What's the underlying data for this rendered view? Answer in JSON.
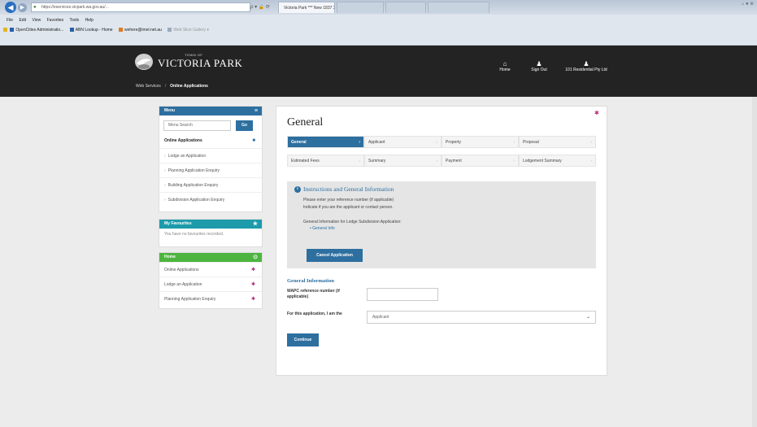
{
  "browser": {
    "url": "https://eservices.vicpark.wa.gov.au/...",
    "tabs": [
      "Victoria Park *** New 1837 3...",
      "",
      "",
      ""
    ],
    "menu": [
      "File",
      "Edit",
      "View",
      "Favorites",
      "Tools",
      "Help"
    ],
    "favorites": [
      "OpenCities Administratio...",
      "ABN Lookup - Home",
      "wehere@imel.net.au",
      "Web Slice Gallery ▾"
    ]
  },
  "site": {
    "logo_small": "TOWN OF",
    "logo_main": "VICTORIA PARK",
    "breadcrumb": [
      "Web Services",
      "/",
      "Online Applications"
    ],
    "header_links": [
      {
        "label": "Home",
        "icon": "home-icon"
      },
      {
        "label": "Sign Out",
        "icon": "user-icon"
      },
      {
        "label": "101 Residential Pty Ltd",
        "icon": "user-icon"
      }
    ]
  },
  "sidebar": {
    "menu_title": "Menu",
    "search_placeholder": "Menu Search",
    "search_btn": "Go",
    "menu_items": [
      {
        "label": "Online Applications"
      },
      {
        "label": "Lodge an Application"
      },
      {
        "label": "Planning Application Enquiry"
      },
      {
        "label": "Building Application Enquiry"
      },
      {
        "label": "Subdivision Application Enquiry"
      }
    ],
    "favourites_title": "My Favourites",
    "favourites_empty": "You have no favourites recorded.",
    "home_title": "Home",
    "home_items": [
      {
        "label": "Online Applications"
      },
      {
        "label": "Lodge an Application"
      },
      {
        "label": "Planning Application Enquiry"
      }
    ]
  },
  "main": {
    "title": "General",
    "steps": [
      {
        "label": "General",
        "active": true
      },
      {
        "label": "Applicant",
        "active": false
      },
      {
        "label": "Property",
        "active": false
      },
      {
        "label": "Proposal",
        "active": false
      },
      {
        "label": "Estimated Fees",
        "active": false
      },
      {
        "label": "Summary",
        "active": false
      },
      {
        "label": "Payment",
        "active": false
      },
      {
        "label": "Lodgement Summary",
        "active": false
      }
    ],
    "info_title": "Instructions and General Information",
    "info_lines": [
      "Please enter your reference number (if applicable)",
      "Indicate if you are the applicant or contact person.",
      "General Information for Lodge Subdivision Application:"
    ],
    "info_link": "General Info",
    "cancel_btn": "Cancel Application",
    "section_title": "General Information",
    "wapc_label": "WAPC reference number (if applicable)",
    "wapc_value": "",
    "role_label": "For this application, I am the",
    "role_value": "Applicant",
    "continue_btn": "Continue"
  },
  "colors": {
    "primary": "#2d6f9f",
    "header_bg": "#232323",
    "favourites": "#1d9bab",
    "home": "#4db53f",
    "star": "#b82b7a"
  }
}
